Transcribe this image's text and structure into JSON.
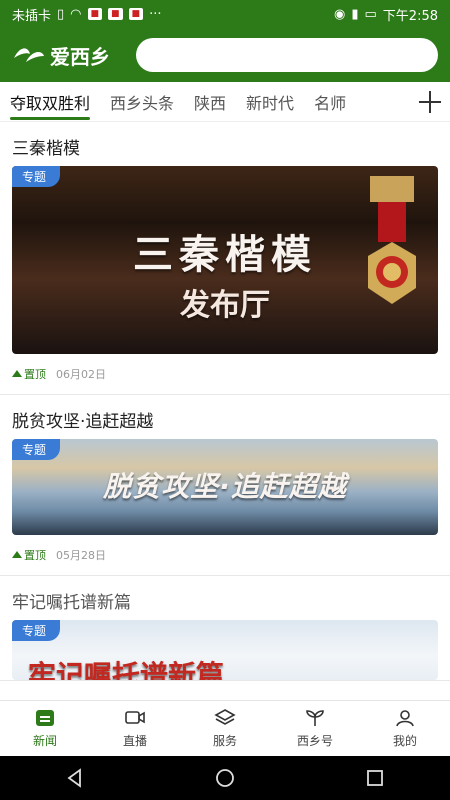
{
  "status_bar": {
    "carrier": "未插卡",
    "time": "下午2:58",
    "icons": [
      "sim-icon",
      "wifi-icon",
      "eye-icon",
      "vibrate-icon",
      "battery-icon"
    ]
  },
  "app": {
    "logo_text": "爱西乡",
    "search_placeholder": ""
  },
  "tabs": [
    {
      "label": "夺取双胜利",
      "active": true
    },
    {
      "label": "西乡头条",
      "active": false
    },
    {
      "label": "陕西",
      "active": false
    },
    {
      "label": "新时代",
      "active": false
    },
    {
      "label": "名师",
      "active": false
    }
  ],
  "feed": [
    {
      "title": "三秦楷模",
      "badge": "专题",
      "banner_line1": "三秦楷模",
      "banner_line2": "发布厅",
      "pinned_label": "置顶",
      "date": "06月02日"
    },
    {
      "title": "脱贫攻坚·追赶超越",
      "badge": "专题",
      "banner_line1": "脱贫攻坚·追赶超越",
      "pinned_label": "置顶",
      "date": "05月28日"
    },
    {
      "title": "牢记嘱托谱新篇",
      "badge": "专题",
      "banner_line1": "牢记嘱托谱新篇"
    }
  ],
  "bottom_nav": [
    {
      "label": "新闻",
      "icon": "news-icon",
      "active": true
    },
    {
      "label": "直播",
      "icon": "live-icon",
      "active": false
    },
    {
      "label": "服务",
      "icon": "layers-icon",
      "active": false
    },
    {
      "label": "西乡号",
      "icon": "sprout-icon",
      "active": false
    },
    {
      "label": "我的",
      "icon": "user-icon",
      "active": false
    }
  ],
  "colors": {
    "brand_green": "#2d7a19",
    "badge_blue": "#3a7bd5"
  }
}
